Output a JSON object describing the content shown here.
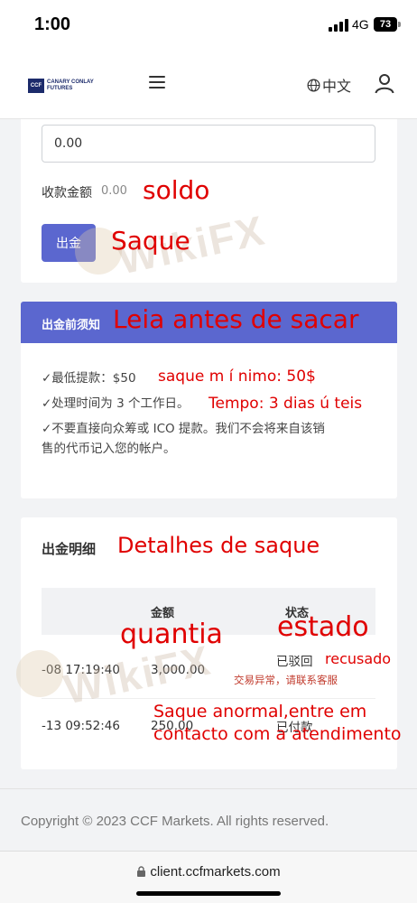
{
  "status_bar": {
    "time": "1:00",
    "network": "4G",
    "battery": "73"
  },
  "header": {
    "logo_mark": "CCF",
    "logo_line1": "CANARY CONLAY",
    "logo_line2": "FUTURES",
    "language": "中文"
  },
  "withdraw_form": {
    "amount_value": "0.00",
    "received_label": "收款金额",
    "received_value": "0.00",
    "submit_label": "出金"
  },
  "notice": {
    "title": "出金前须知",
    "items": [
      "✓最低提款：$50",
      "✓处理时间为 3 个工作日。",
      "✓不要直接向众筹或 ICO 提款。我们不会将来自该销",
      "售的代币记入您的帐户。"
    ]
  },
  "details": {
    "title": "出金明细",
    "columns": [
      "金额",
      "状态"
    ],
    "rows": [
      {
        "time": "-08 17:19:40",
        "amount": "3,000.00",
        "status": "已驳回",
        "reason": "交易异常，请联系客服"
      },
      {
        "time": "-13 09:52:46",
        "amount": "250.00",
        "status": "已付款"
      }
    ]
  },
  "footer": {
    "copyright": "Copyright © 2023 CCF Markets. All rights reserved."
  },
  "browser": {
    "url": "client.ccfmarkets.com"
  },
  "annotations": {
    "soldo": "soldo",
    "saque": "Saque",
    "leia": "Leia antes de sacar",
    "minimo": "saque m í nimo: 50$",
    "tempo": "Tempo: 3 dias ú teis",
    "detalhes": "Detalhes de saque",
    "quantia": "quantia",
    "estado": "estado",
    "recusado": "recusado",
    "anormal1": "Saque anormal,entre em",
    "anormal2": "contacto com a atendimento"
  },
  "watermark": "WikiFX",
  "colors": {
    "accent": "#5b67cf",
    "annotation": "#e00000"
  }
}
